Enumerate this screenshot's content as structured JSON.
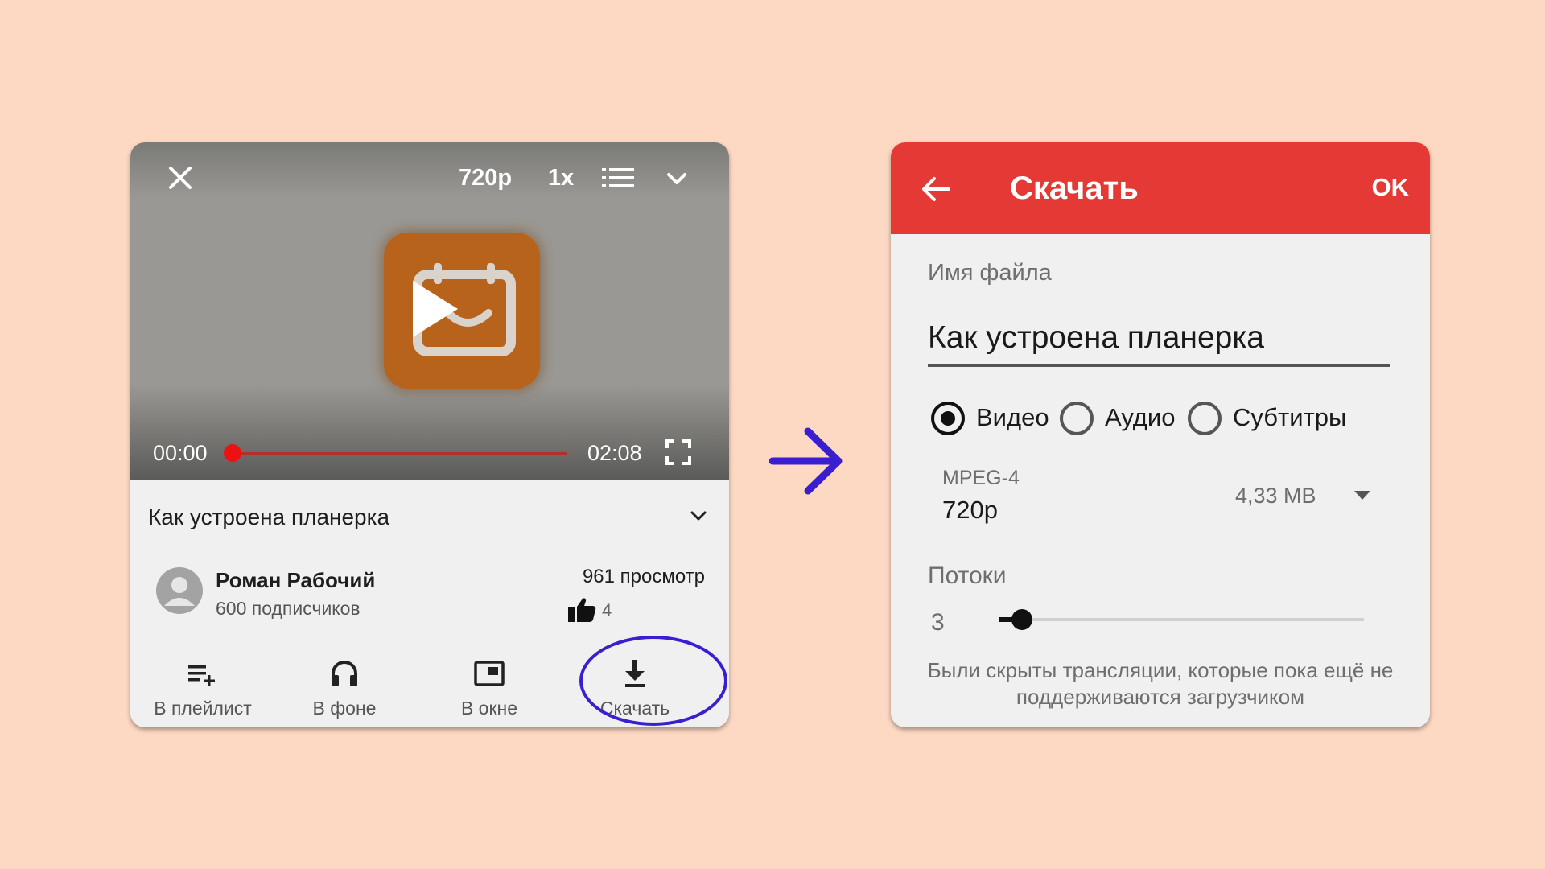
{
  "player": {
    "quality": "720p",
    "speed": "1x",
    "time_current": "00:00",
    "time_total": "02:08",
    "progress": 0.0,
    "title": "Как устроена планерка",
    "channel": {
      "name": "Роман Рабочий",
      "subscribers": "600 подписчиков"
    },
    "views": "961 просмотр",
    "likes": "4",
    "actions": {
      "playlist": "В плейлист",
      "background": "В фоне",
      "popup": "В окне",
      "download": "Скачать"
    },
    "icons": [
      "close-icon",
      "queue-icon",
      "collapse-icon",
      "play-icon",
      "calendar-icon",
      "fullscreen-icon",
      "expand-icon",
      "avatar-icon",
      "thumbs-up-icon",
      "playlist-add-icon",
      "headphones-icon",
      "popup-icon",
      "download-icon"
    ]
  },
  "dialog": {
    "title": "Скачать",
    "ok_label": "OK",
    "filename_label": "Имя файла",
    "filename_value": "Как устроена планерка",
    "options": {
      "video": "Видео",
      "audio": "Аудио",
      "subtitles": "Субтитры",
      "selected": "video"
    },
    "format": {
      "name": "MPEG-4",
      "quality": "720p",
      "size": "4,33 MB"
    },
    "threads_label": "Потоки",
    "threads_value": "3",
    "notice": "Были скрыты трансляции, которые пока ещё не поддерживаются загрузчиком",
    "icons": [
      "back-icon",
      "dropdown-icon"
    ]
  },
  "colors": {
    "background": "#fdd8c2",
    "header_red": "#e53935",
    "highlight": "#3a1fcf",
    "seek_red": "#ee1111",
    "thumbnail_orange": "#b8631c"
  }
}
